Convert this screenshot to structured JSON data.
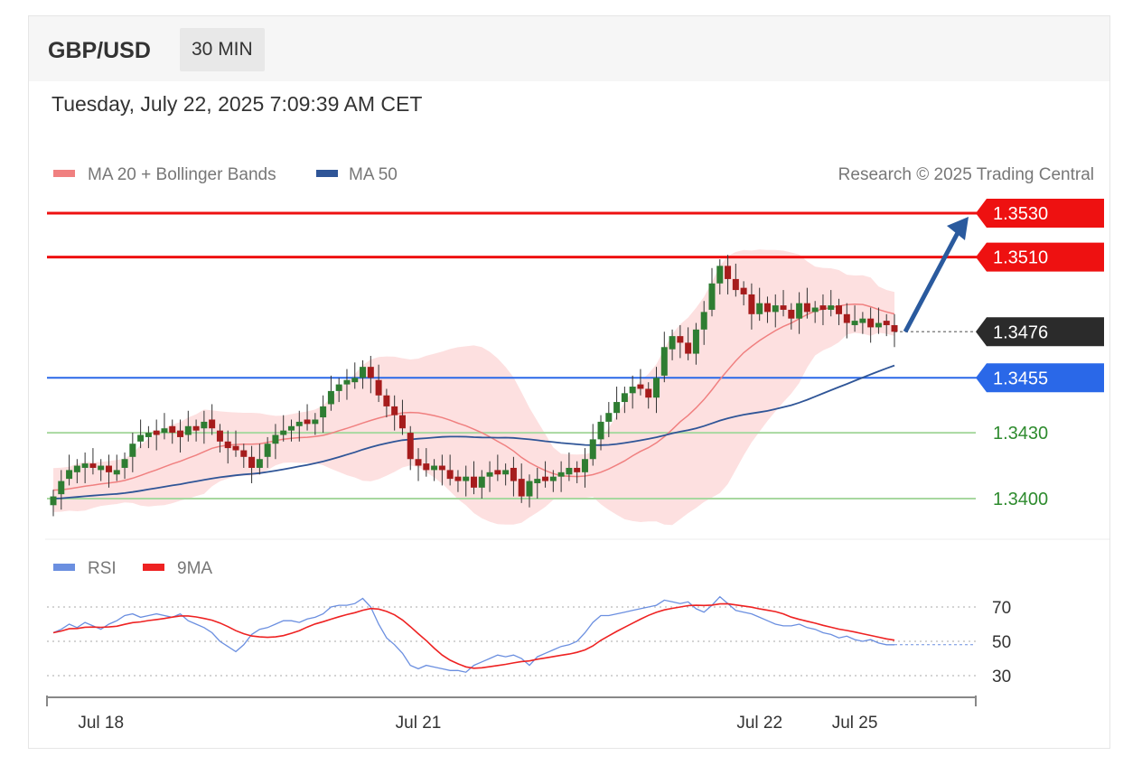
{
  "header": {
    "pair": "GBP/USD",
    "timeframe": "30 MIN",
    "datetime": "Tuesday, July 22, 2025 7:09:39 AM CET"
  },
  "legend": {
    "ma20": "MA 20 + Bollinger Bands",
    "ma50": "MA 50",
    "credit": "Research © 2025 Trading Central",
    "rsi": "RSI",
    "rsi_ma": "9MA"
  },
  "colors": {
    "ma20": "#f08080",
    "ma50": "#2f5597",
    "band_fill": "#fde0e0",
    "up_candle": "#2e7d32",
    "down_candle": "#a61c1c",
    "resistance": "#ee1111",
    "pivot": "#2a68e8",
    "support": "#a8d8a0",
    "support_text": "#2e8b2e",
    "current": "#2b2b2b",
    "arrow": "#2a5a9e",
    "rsi": "#6b8fe0",
    "rsi_ma": "#ee2222"
  },
  "chart_data": {
    "type": "candlestick",
    "symbol": "GBP/USD",
    "timeframe": "30 MIN",
    "ylim": [
      1.3392,
      1.3538
    ],
    "levels": [
      {
        "label": "1.3530",
        "value": 1.353,
        "kind": "resistance"
      },
      {
        "label": "1.3510",
        "value": 1.351,
        "kind": "resistance"
      },
      {
        "label": "1.3476",
        "value": 1.3476,
        "kind": "current"
      },
      {
        "label": "1.3455",
        "value": 1.3455,
        "kind": "pivot"
      },
      {
        "label": "1.3430",
        "value": 1.343,
        "kind": "support"
      },
      {
        "label": "1.3400",
        "value": 1.34,
        "kind": "support"
      }
    ],
    "x_ticks": [
      {
        "label": "Jul 18",
        "index": 6
      },
      {
        "label": "Jul 21",
        "index": 46
      },
      {
        "label": "Jul 22",
        "index": 89
      },
      {
        "label": "Jul 25",
        "index": 101
      }
    ],
    "close": [
      1.3401,
      1.3408,
      1.3413,
      1.3415,
      1.3416,
      1.3414,
      1.3415,
      1.3412,
      1.3413,
      1.3418,
      1.3425,
      1.3429,
      1.343,
      1.3429,
      1.3432,
      1.343,
      1.3428,
      1.3433,
      1.3431,
      1.3435,
      1.3432,
      1.3426,
      1.3423,
      1.3422,
      1.3419,
      1.3414,
      1.3418,
      1.3425,
      1.3429,
      1.3431,
      1.3433,
      1.3435,
      1.3434,
      1.3436,
      1.3442,
      1.3449,
      1.3452,
      1.3454,
      1.3455,
      1.346,
      1.3455,
      1.3447,
      1.3442,
      1.3438,
      1.3432,
      1.3418,
      1.3415,
      1.3413,
      1.3415,
      1.3413,
      1.3409,
      1.3408,
      1.341,
      1.3405,
      1.341,
      1.3412,
      1.3411,
      1.3413,
      1.3408,
      1.3401,
      1.3408,
      1.3409,
      1.3408,
      1.341,
      1.3412,
      1.3414,
      1.3412,
      1.3418,
      1.3427,
      1.3435,
      1.3439,
      1.3444,
      1.3448,
      1.3451,
      1.345,
      1.3446,
      1.3455,
      1.3469,
      1.3474,
      1.3471,
      1.3466,
      1.3477,
      1.3485,
      1.3498,
      1.3506,
      1.35,
      1.3495,
      1.3493,
      1.3484,
      1.3489,
      1.3485,
      1.3488,
      1.3486,
      1.3482,
      1.3489,
      1.3485,
      1.3487,
      1.3486,
      1.3488,
      1.3484,
      1.348,
      1.3481,
      1.3482,
      1.3478,
      1.348,
      1.3479,
      1.3476
    ],
    "open_offsets": [
      -0.0004,
      -0.0006,
      -0.0004,
      -0.0003,
      -0.0002,
      0.0002,
      -0.0002,
      0.0003,
      -0.0002,
      -0.0004,
      -0.0006,
      -0.0003,
      -0.0002,
      0.0002,
      -0.0002,
      0.0003,
      0.0003,
      -0.0004,
      0.0002,
      -0.0003,
      0.0004,
      0.0005,
      0.0003,
      0.0002,
      0.0003,
      0.0005,
      -0.0004,
      -0.0006,
      -0.0004,
      -0.0002,
      -0.0002,
      -0.0002,
      0.0002,
      -0.0002,
      -0.0005,
      -0.0006,
      -0.0003,
      -0.0002,
      -0.0002,
      -0.0005,
      0.0005,
      0.0007,
      0.0005,
      0.0004,
      0.0006,
      0.0012,
      0.0003,
      0.0003,
      -0.0002,
      0.0002,
      0.0004,
      0.0002,
      -0.0002,
      0.0005,
      -0.0005,
      -0.0002,
      0.0002,
      -0.0002,
      0.0006,
      0.0008,
      -0.0007,
      -0.0002,
      0.0002,
      -0.0002,
      -0.0002,
      -0.0003,
      0.0002,
      -0.0006,
      -0.0009,
      -0.0008,
      -0.0004,
      -0.0005,
      -0.0004,
      -0.0003,
      0.0002,
      0.0004,
      -0.0009,
      -0.0013,
      -0.0006,
      0.0003,
      0.0005,
      -0.0011,
      -0.0008,
      -0.0012,
      -0.0008,
      0.0006,
      0.0005,
      0.0003,
      0.0009,
      -0.0005,
      0.0004,
      -0.0003,
      0.0002,
      0.0004,
      -0.0007,
      0.0004,
      -0.0002,
      0.0002,
      -0.0002,
      0.0004,
      0.0004,
      -0.0002,
      -0.0002,
      0.0004,
      -0.0002,
      0.0002,
      0.0003
    ],
    "ma20_start": 1.3404,
    "ma50_start": 1.34,
    "rsi": [
      55,
      57,
      60,
      58,
      61,
      59,
      57,
      60,
      62,
      65,
      66,
      64,
      65,
      66,
      65,
      64,
      66,
      62,
      60,
      58,
      55,
      50,
      47,
      44,
      48,
      54,
      57,
      58,
      60,
      62,
      62,
      61,
      63,
      64,
      66,
      70,
      71,
      71,
      72,
      75,
      70,
      60,
      52,
      48,
      43,
      36,
      34,
      36,
      35,
      34,
      33,
      33,
      32,
      36,
      38,
      40,
      42,
      41,
      42,
      40,
      36,
      41,
      43,
      45,
      47,
      48,
      50,
      55,
      61,
      65,
      65,
      66,
      67,
      68,
      69,
      70,
      71,
      74,
      73,
      72,
      73,
      69,
      67,
      71,
      76,
      72,
      68,
      67,
      66,
      64,
      62,
      60,
      59,
      59,
      60,
      58,
      57,
      55,
      54,
      52,
      53,
      51,
      50,
      51,
      49,
      48,
      48
    ],
    "rsi_ticks": [
      70,
      50,
      30
    ]
  }
}
